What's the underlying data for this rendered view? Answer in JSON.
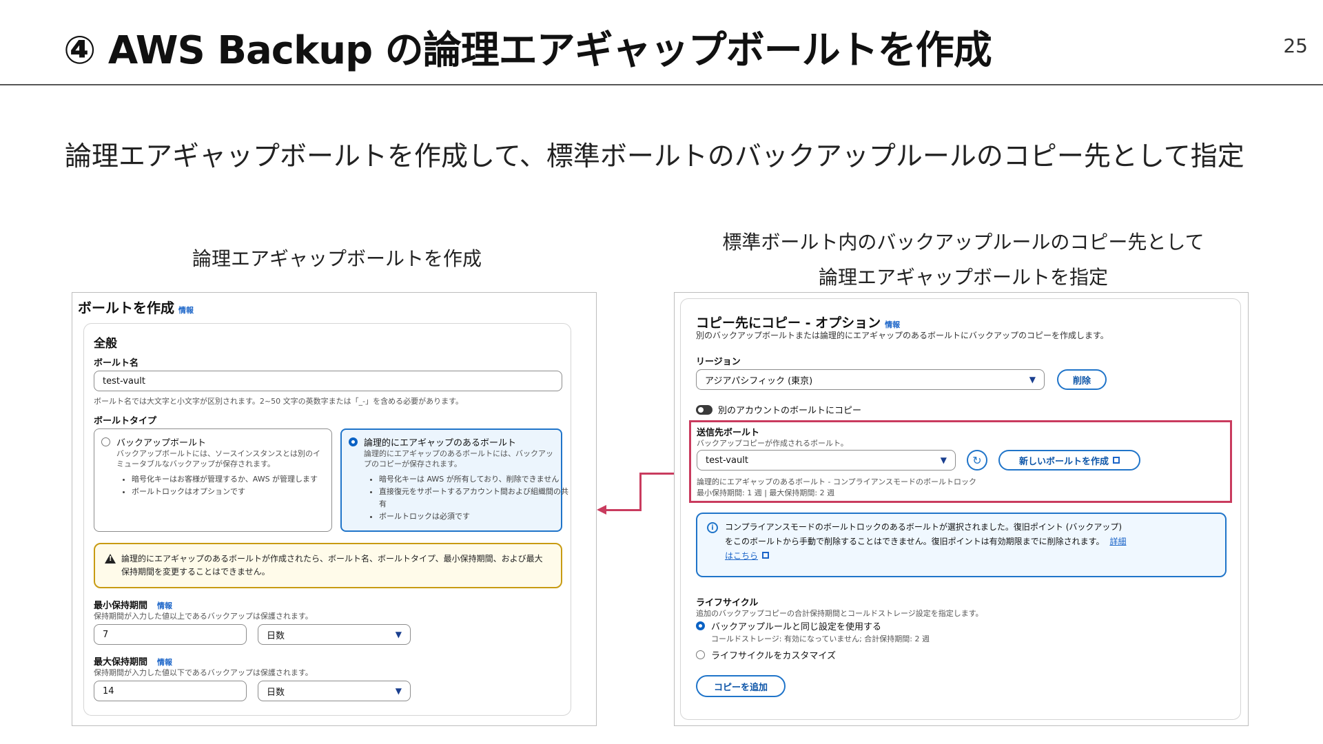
{
  "slide": {
    "title": "④ AWS Backup の論理エアギャップボールトを作成",
    "page_number": "25",
    "subtitle": "論理エアギャップボールトを作成して、標準ボールトのバックアップルールのコピー先として指定",
    "left_caption": "論理エアギャップボールトを作成",
    "right_caption_line1": "標準ボールト内のバックアップルールのコピー先として",
    "right_caption_line2": "論理エアギャップボールトを指定"
  },
  "left_panel": {
    "title": "ボールトを作成",
    "info": "情報",
    "section_title": "全般",
    "vault_name_label": "ボールト名",
    "vault_name_value": "test-vault",
    "vault_name_hint": "ボールト名では大文字と小文字が区別されます。2~50 文字の英数字または「_-」を含める必要があります。",
    "vault_type_label": "ボールトタイプ",
    "option_backup": {
      "title": "バックアップボールト",
      "desc": "バックアップボールトには、ソースインスタンスとは別のイミュータブルなバックアップが保存されます。",
      "bullets": [
        "暗号化キーはお客様が管理するか、AWS が管理します",
        "ボールトロックはオプションです"
      ]
    },
    "option_airgap": {
      "title": "論理的にエアギャップのあるボールト",
      "desc": "論理的にエアギャップのあるボールトには、バックアップのコピーが保存されます。",
      "bullets": [
        "暗号化キーは AWS が所有しており、削除できません",
        "直接復元をサポートするアカウント間および組織間の共有",
        "ボールトロックは必須です"
      ]
    },
    "warning": "論理的にエアギャップのあるボールトが作成されたら、ボールト名、ボールトタイプ、最小保持期間、および最大保持期間を変更することはできません。",
    "min_retention_label": "最小保持期間",
    "min_retention_hint": "保持期間が入力した値以上であるバックアップは保護されます。",
    "min_retention_value": "7",
    "min_retention_unit": "日数",
    "max_retention_label": "最大保持期間",
    "max_retention_hint": "保持期間が入力した値以下であるバックアップは保護されます。",
    "max_retention_value": "14",
    "max_retention_unit": "日数"
  },
  "right_panel": {
    "title": "コピー先にコピー - オプション",
    "info": "情報",
    "desc": "別のバックアップボールトまたは論理的にエアギャップのあるボールトにバックアップのコピーを作成します。",
    "region_label": "リージョン",
    "region_value": "アジアパシフィック (東京)",
    "delete_button": "削除",
    "toggle_label": "別のアカウントのボールトにコピー",
    "dest_vault_label": "送信先ボールト",
    "dest_vault_hint": "バックアップコピーが作成されるボールト。",
    "dest_vault_value": "test-vault",
    "new_vault_button": "新しいボールトを作成",
    "vault_meta_line1": "論理的にエアギャップのあるボールト - コンプライアンスモードのボールトロック",
    "vault_meta_line2": "最小保持期間: 1 週 | 最大保持期間: 2 週",
    "info_alert_line1": "コンプライアンスモードのボールトロックのあるボールトが選択されました。復旧ポイント (バックアップ)",
    "info_alert_line2": "をこのボールトから手動で削除することはできません。復旧ポイントは有効期限までに削除されます。",
    "info_alert_link1": "詳細",
    "info_alert_link2": "はこちら",
    "lifecycle_label": "ライフサイクル",
    "lifecycle_hint": "追加のバックアップコピーの合計保持期間とコールドストレージ設定を指定します。",
    "lifecycle_option1": "バックアップルールと同じ設定を使用する",
    "lifecycle_option1_hint": "コールドストレージ: 有効になっていません; 合計保持期間: 2 週",
    "lifecycle_option2": "ライフサイクルをカスタマイズ",
    "add_copy_button": "コピーを追加"
  },
  "colors": {
    "accent_blue": "#1f74c9",
    "highlight_red": "#c93b5e",
    "warning_border": "#c89b12"
  }
}
